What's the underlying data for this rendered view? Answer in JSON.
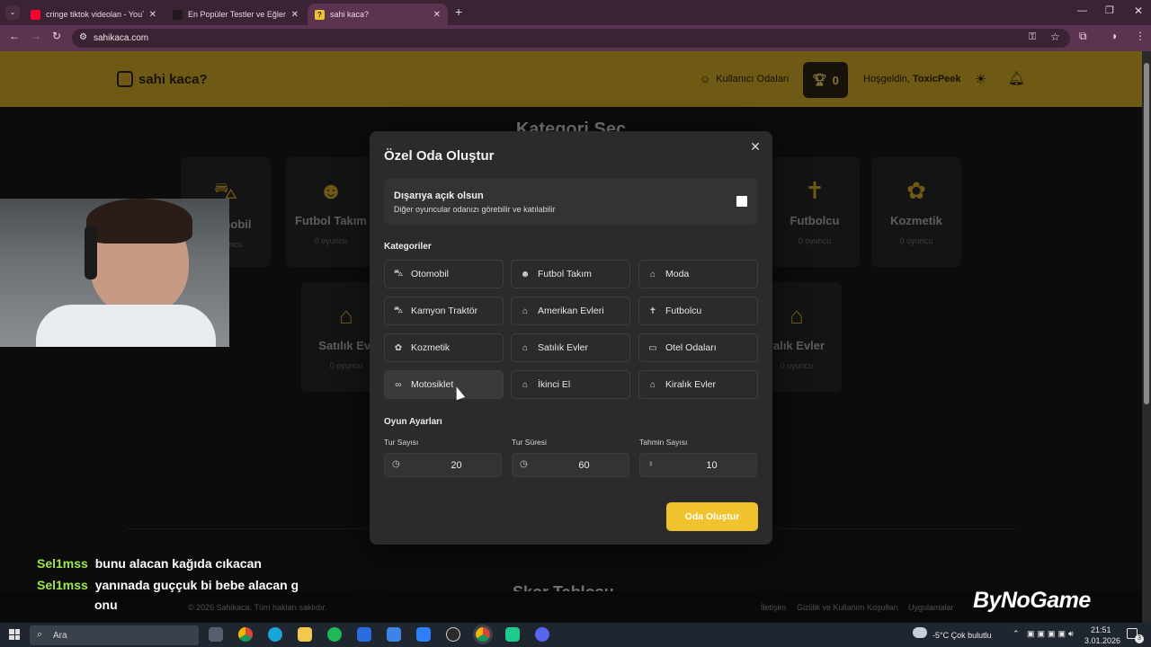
{
  "browser": {
    "tabs": [
      {
        "title": "cringe tiktok videolan - YouTube",
        "favicon_color": "#ff0033"
      },
      {
        "title": "En Popüler Testler ve Eğlenceli Q",
        "favicon_color": "#3b2b35"
      },
      {
        "title": "sahi kaca?",
        "favicon_color": "#f0c22e"
      }
    ],
    "url": "sahikaca.com"
  },
  "header": {
    "logo": "sahi kaca?",
    "user_rooms": "Kullanıcı Odaları",
    "trophy_count": "0",
    "welcome": "Hoşgeldin,",
    "username": "ToxicPeek"
  },
  "background": {
    "title": "Kategori Seç",
    "cards": [
      {
        "name": "Otomobil",
        "count": "0 oyuncu"
      },
      {
        "name": "Futbol Takım",
        "count": "0 oyuncu"
      },
      {
        "name": "Futbolcu",
        "count": "0 oyuncu"
      },
      {
        "name": "Kozmetik",
        "count": "0 oyuncu"
      },
      {
        "name": "Satılık Evl",
        "count": "0 oyuncu"
      },
      {
        "name": "ralık Evler",
        "count": "0 oyuncu"
      }
    ],
    "lower_title": "Skor Tablosu"
  },
  "modal": {
    "title": "Özel Oda Oluştur",
    "public_title": "Dışarıya açık olsun",
    "public_desc": "Diğer oyuncular odanızı görebilir ve katılabilir",
    "categories_label": "Kategoriler",
    "categories": [
      {
        "label": "Otomobil",
        "icon": "car-icon",
        "glyph": "⛍"
      },
      {
        "label": "Futbol Takım",
        "icon": "users-icon",
        "glyph": "☻"
      },
      {
        "label": "Moda",
        "icon": "basket-icon",
        "glyph": "⌂"
      },
      {
        "label": "Kamyon Traktör",
        "icon": "truck-icon",
        "glyph": "⛍"
      },
      {
        "label": "Amerikan Evleri",
        "icon": "house-icon",
        "glyph": "⌂"
      },
      {
        "label": "Futbolcu",
        "icon": "person-icon",
        "glyph": "✝"
      },
      {
        "label": "Kozmetik",
        "icon": "flower-icon",
        "glyph": "✿"
      },
      {
        "label": "Satılık Evler",
        "icon": "house-plus-icon",
        "glyph": "⌂"
      },
      {
        "label": "Otel Odaları",
        "icon": "bed-icon",
        "glyph": "▭"
      },
      {
        "label": "Motosiklet",
        "icon": "bike-icon",
        "glyph": "∞"
      },
      {
        "label": "İkinci El",
        "icon": "basket-icon",
        "glyph": "⌂"
      },
      {
        "label": "Kiralık Evler",
        "icon": "house-icon",
        "glyph": "⌂"
      }
    ],
    "settings_label": "Oyun Ayarları",
    "fields": [
      {
        "label": "Tur Sayısı",
        "value": "20",
        "icon": "clock-icon"
      },
      {
        "label": "Tur Süresi",
        "value": "60",
        "icon": "clock-icon"
      },
      {
        "label": "Tahmin Sayısı",
        "value": "10",
        "icon": "bulb-icon"
      }
    ],
    "create_button": "Oda Oluştur"
  },
  "chat": [
    {
      "user": "Sel1mss",
      "message": "bunu alacan kağıda cıkacan"
    },
    {
      "user": "Sel1mss",
      "message": "yanınada guççuk bi bebe alacan gö"
    },
    {
      "user": "",
      "message": "onu"
    }
  ],
  "footer": {
    "copyright": "© 2026 Sahikaca. Tüm hakları saklıdır.",
    "links": [
      "İletişim",
      "Gizlilik ve Kullanım Koşulları",
      "Uygulamalar"
    ]
  },
  "watermark": "ByNoGame",
  "taskbar": {
    "search_placeholder": "Ara",
    "weather": "-5°C  Çok bulutlu",
    "time": "21:51",
    "date": "3.01.2026",
    "notif_count": "3"
  }
}
